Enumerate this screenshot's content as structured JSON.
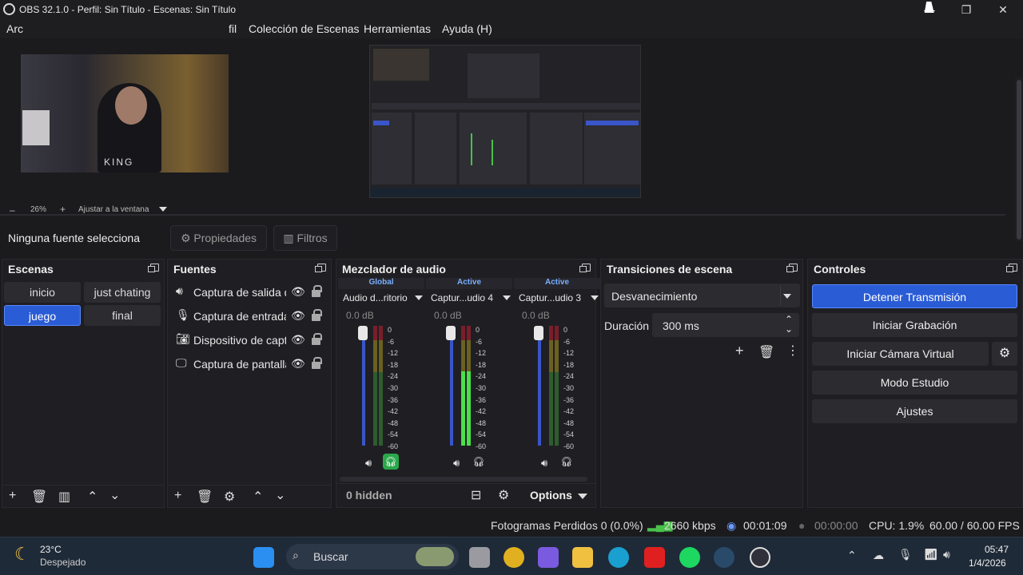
{
  "window": {
    "title": "OBS 32.1.0 - Perfil: Sin Título - Escenas: Sin Título",
    "minimize": "—",
    "maximize": "❐",
    "close": "✕"
  },
  "menu": {
    "items": [
      "Arc",
      "fil",
      "Colección de Escenas",
      "Herramientas",
      "Ayuda (H)"
    ]
  },
  "preview": {
    "overlay_text": "KING",
    "zoom_level": "26%",
    "zoom_minus": "–",
    "zoom_plus": "+",
    "fit_label": "Ajustar a la ventana"
  },
  "source_toolbar": {
    "selection_label": "Ninguna fuente selecciona",
    "properties_label": "Propiedades",
    "filters_label": "Filtros"
  },
  "scenes": {
    "title": "Escenas",
    "items": [
      "inicio",
      "just chating",
      "juego",
      "final"
    ],
    "selected": "juego"
  },
  "sources": {
    "title": "Fuentes",
    "items": [
      {
        "icon": "speaker-icon",
        "name": "Captura de salida d"
      },
      {
        "icon": "microphone-icon",
        "name": "Captura de entrada"
      },
      {
        "icon": "camera-icon",
        "name": "Dispositivo de capt"
      },
      {
        "icon": "monitor-icon",
        "name": "Captura de pantalla"
      }
    ]
  },
  "mixer": {
    "title": "Mezclador de audio",
    "channels": [
      {
        "header": "Global",
        "name": "Audio d...ritorio",
        "db": "0.0 dB",
        "level": 0.0,
        "monitor_on": true
      },
      {
        "header": "Active",
        "name": "Captur...udio 4",
        "db": "0.0 dB",
        "level": 0.62,
        "monitor_on": false
      },
      {
        "header": "Active",
        "name": "Captur...udio 3",
        "db": "0.0 dB",
        "level": 0.0,
        "monitor_on": false
      }
    ],
    "scale": [
      "0",
      "-6",
      "-12",
      "-18",
      "-24",
      "-30",
      "-36",
      "-42",
      "-48",
      "-54",
      "-60"
    ],
    "hidden_label": "0 hidden",
    "options_label": "Options"
  },
  "transitions": {
    "title": "Transiciones de escena",
    "selected": "Desvanecimiento",
    "duration_label": "Duración",
    "duration_value": "300 ms"
  },
  "controls": {
    "title": "Controles",
    "stop_stream": "Detener Transmisión",
    "start_recording": "Iniciar Grabación",
    "start_virtual_cam": "Iniciar Cámara Virtual",
    "studio_mode": "Modo Estudio",
    "settings": "Ajustes"
  },
  "status": {
    "dropped_frames": "Fotogramas Perdidos 0 (0.0%)",
    "bitrate": "2660 kbps",
    "stream_time": "00:01:09",
    "rec_time": "00:00:00",
    "cpu": "CPU: 1.9%",
    "fps": "60.00 / 60.00 FPS"
  },
  "taskbar": {
    "temperature": "23°C",
    "weather": "Despejado",
    "search_placeholder": "Buscar",
    "time": "05:47",
    "date": "1/4/2026"
  }
}
